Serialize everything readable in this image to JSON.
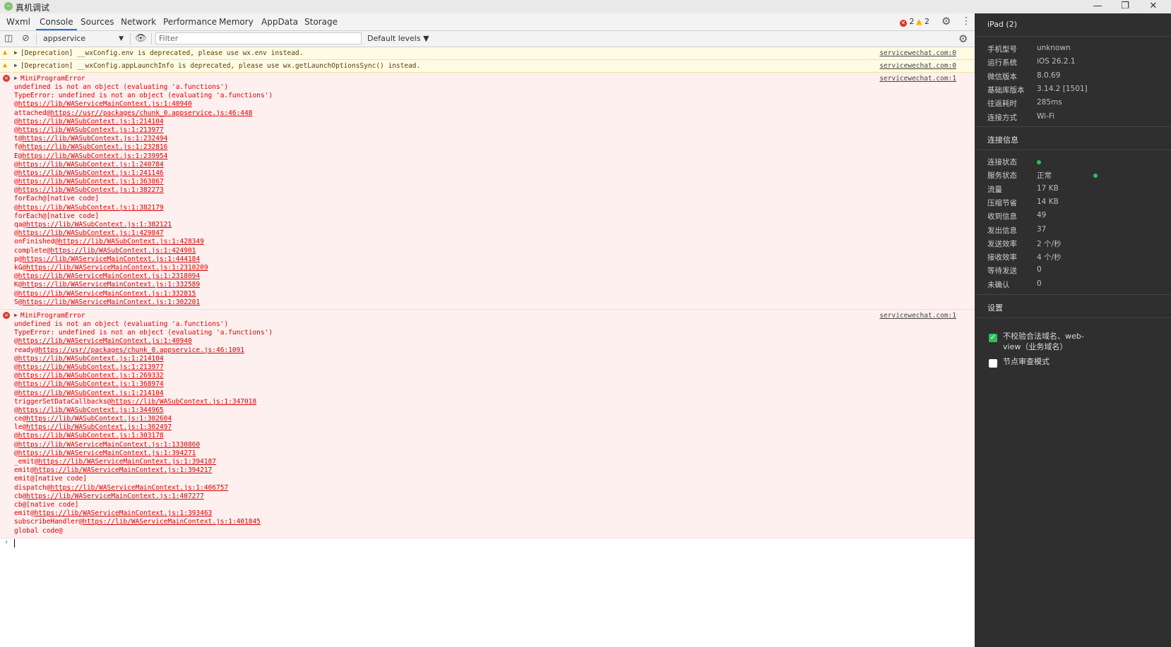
{
  "window": {
    "title": "真机调试",
    "logo_glyph": "~",
    "controls": {
      "minimize": "—",
      "restore": "❐",
      "close": "✕"
    }
  },
  "tabs": [
    {
      "label": "Wxml"
    },
    {
      "label": "Console"
    },
    {
      "label": "Sources"
    },
    {
      "label": "Network"
    },
    {
      "label": "Performance"
    },
    {
      "label": "Memory"
    },
    {
      "label": "AppData"
    },
    {
      "label": "Storage"
    }
  ],
  "active_tab": "Console",
  "counts": {
    "errors": "2",
    "warnings": "2"
  },
  "toolbar": {
    "context": "appservice",
    "filter_placeholder": "Filter",
    "levels": "Default levels ▼"
  },
  "console": {
    "warnings": [
      {
        "message": "[Deprecation] __wxConfig.env is deprecated, please use wx.env instead.",
        "source": "servicewechat.com:0"
      },
      {
        "message": "[Deprecation] __wxConfig.appLaunchInfo is deprecated, please use wx.getLaunchOptionsSync() instead.",
        "source": "servicewechat.com:0"
      }
    ],
    "errors": [
      {
        "title": "MiniProgramError",
        "source": "servicewechat.com:1",
        "lines": [
          {
            "pre": "undefined is not an object (evaluating 'a.functions')",
            "link": ""
          },
          {
            "pre": "TypeError: undefined is not an object (evaluating 'a.functions')",
            "link": ""
          },
          {
            "pre": "@",
            "link": "https://lib/WAServiceMainContext.js:1:40940"
          },
          {
            "pre": "attached@",
            "link": "https://usr//packages/chunk_0.appservice.js:46:448"
          },
          {
            "pre": "@",
            "link": "https://lib/WASubContext.js:1:214104"
          },
          {
            "pre": "@",
            "link": "https://lib/WASubContext.js:1:213977"
          },
          {
            "pre": "t@",
            "link": "https://lib/WASubContext.js:1:232494"
          },
          {
            "pre": "f@",
            "link": "https://lib/WASubContext.js:1:232816"
          },
          {
            "pre": "E@",
            "link": "https://lib/WASubContext.js:1:239954"
          },
          {
            "pre": "@",
            "link": "https://lib/WASubContext.js:1:240784"
          },
          {
            "pre": "@",
            "link": "https://lib/WASubContext.js:1:241146"
          },
          {
            "pre": "@",
            "link": "https://lib/WASubContext.js:1:363867"
          },
          {
            "pre": "@",
            "link": "https://lib/WASubContext.js:1:382273"
          },
          {
            "pre": "forEach@[native code]",
            "link": ""
          },
          {
            "pre": "@",
            "link": "https://lib/WASubContext.js:1:382179"
          },
          {
            "pre": "forEach@[native code]",
            "link": ""
          },
          {
            "pre": "qa@",
            "link": "https://lib/WASubContext.js:1:382121"
          },
          {
            "pre": "@",
            "link": "https://lib/WASubContext.js:1:429847"
          },
          {
            "pre": "onFinished@",
            "link": "https://lib/WASubContext.js:1:428349"
          },
          {
            "pre": "complete@",
            "link": "https://lib/WASubContext.js:1:424901"
          },
          {
            "pre": "p@",
            "link": "https://lib/WAServiceMainContext.js:1:444184"
          },
          {
            "pre": "kG@",
            "link": "https://lib/WAServiceMainContext.js:1:2310209"
          },
          {
            "pre": "@",
            "link": "https://lib/WAServiceMainContext.js:1:2318094"
          },
          {
            "pre": "K@",
            "link": "https://lib/WAServiceMainContext.js:1:332589"
          },
          {
            "pre": "@",
            "link": "https://lib/WAServiceMainContext.js:1:332815"
          },
          {
            "pre": "S@",
            "link": "https://lib/WAServiceMainContext.js:1:302201"
          }
        ]
      },
      {
        "title": "MiniProgramError",
        "source": "servicewechat.com:1",
        "lines": [
          {
            "pre": "undefined is not an object (evaluating 'a.functions')",
            "link": ""
          },
          {
            "pre": "TypeError: undefined is not an object (evaluating 'a.functions')",
            "link": ""
          },
          {
            "pre": "@",
            "link": "https://lib/WAServiceMainContext.js:1:40940"
          },
          {
            "pre": "ready@",
            "link": "https://usr//packages/chunk_0.appservice.js:46:1091"
          },
          {
            "pre": "@",
            "link": "https://lib/WASubContext.js:1:214104"
          },
          {
            "pre": "@",
            "link": "https://lib/WASubContext.js:1:213977"
          },
          {
            "pre": "@",
            "link": "https://lib/WASubContext.js:1:269332"
          },
          {
            "pre": "@",
            "link": "https://lib/WASubContext.js:1:368974"
          },
          {
            "pre": "@",
            "link": "https://lib/WASubContext.js:1:214104"
          },
          {
            "pre": "triggerSetDataCallbacks@",
            "link": "https://lib/WASubContext.js:1:347018"
          },
          {
            "pre": "@",
            "link": "https://lib/WASubContext.js:1:344965"
          },
          {
            "pre": "ce@",
            "link": "https://lib/WASubContext.js:1:302604"
          },
          {
            "pre": "le@",
            "link": "https://lib/WASubContext.js:1:302497"
          },
          {
            "pre": "@",
            "link": "https://lib/WASubContext.js:1:303178"
          },
          {
            "pre": "@",
            "link": "https://lib/WAServiceMainContext.js:1:1330860"
          },
          {
            "pre": "@",
            "link": "https://lib/WAServiceMainContext.js:1:394271"
          },
          {
            "pre": "_emit@",
            "link": "https://lib/WAServiceMainContext.js:1:394187"
          },
          {
            "pre": "emit@",
            "link": "https://lib/WAServiceMainContext.js:1:394217"
          },
          {
            "pre": "emit@[native code]",
            "link": ""
          },
          {
            "pre": "dispatch@",
            "link": "https://lib/WAServiceMainContext.js:1:406757"
          },
          {
            "pre": "cb@",
            "link": "https://lib/WAServiceMainContext.js:1:407277"
          },
          {
            "pre": "cb@[native code]",
            "link": ""
          },
          {
            "pre": "emit@",
            "link": "https://lib/WAServiceMainContext.js:1:393463"
          },
          {
            "pre": "subscribeHandler@",
            "link": "https://lib/WAServiceMainContext.js:1:401845"
          },
          {
            "pre": "global code@",
            "link": ""
          }
        ]
      }
    ],
    "prompt": "›"
  },
  "sidebar": {
    "device": "iPad (2)",
    "device_info": [
      {
        "k": "手机型号",
        "v": "unknown"
      },
      {
        "k": "运行系统",
        "v": "iOS 26.2.1"
      },
      {
        "k": "微信版本",
        "v": "8.0.69"
      },
      {
        "k": "基础库版本",
        "v": "3.14.2 [1501]"
      },
      {
        "k": "往返耗时",
        "v": "285ms"
      },
      {
        "k": "连接方式",
        "v": "Wi-Fi"
      }
    ],
    "connection_title": "连接信息",
    "connection_info": [
      {
        "k": "连接状态",
        "v": ""
      },
      {
        "k": "服务状态",
        "v": "正常"
      },
      {
        "k": "流量",
        "v": "17 KB"
      },
      {
        "k": "压缩节省",
        "v": "14 KB"
      },
      {
        "k": "收到信息",
        "v": "49"
      },
      {
        "k": "发出信息",
        "v": "37"
      },
      {
        "k": "发送效率",
        "v": "2 个/秒"
      },
      {
        "k": "接收效率",
        "v": "4 个/秒"
      },
      {
        "k": "等待发送",
        "v": "0"
      },
      {
        "k": "未确认",
        "v": "0"
      }
    ],
    "settings_title": "设置",
    "settings": [
      {
        "label": "不校验合法域名、web-view（业务域名）",
        "checked": true
      },
      {
        "label": "节点审查模式",
        "checked": false
      }
    ],
    "status_color": "#2fbf5a"
  }
}
